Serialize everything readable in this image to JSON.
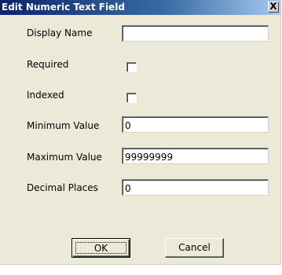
{
  "window": {
    "title": "Edit Numeric Text Field",
    "close_label": "X"
  },
  "form": {
    "display_name": {
      "label": "Display Name",
      "value": ""
    },
    "required": {
      "label": "Required",
      "checked": false
    },
    "indexed": {
      "label": "Indexed",
      "checked": false
    },
    "minimum_value": {
      "label": "Minimum Value",
      "value": "0"
    },
    "maximum_value": {
      "label": "Maximum Value",
      "value": "99999999"
    },
    "decimal_places": {
      "label": "Decimal Places",
      "value": "0"
    }
  },
  "buttons": {
    "ok_label": "OK",
    "cancel_label": "Cancel"
  },
  "colors": {
    "dialog_background": "#ece9d8",
    "titlebar_start": "#0a246a",
    "titlebar_end": "#a6caf0",
    "title_text": "#ffffff"
  }
}
